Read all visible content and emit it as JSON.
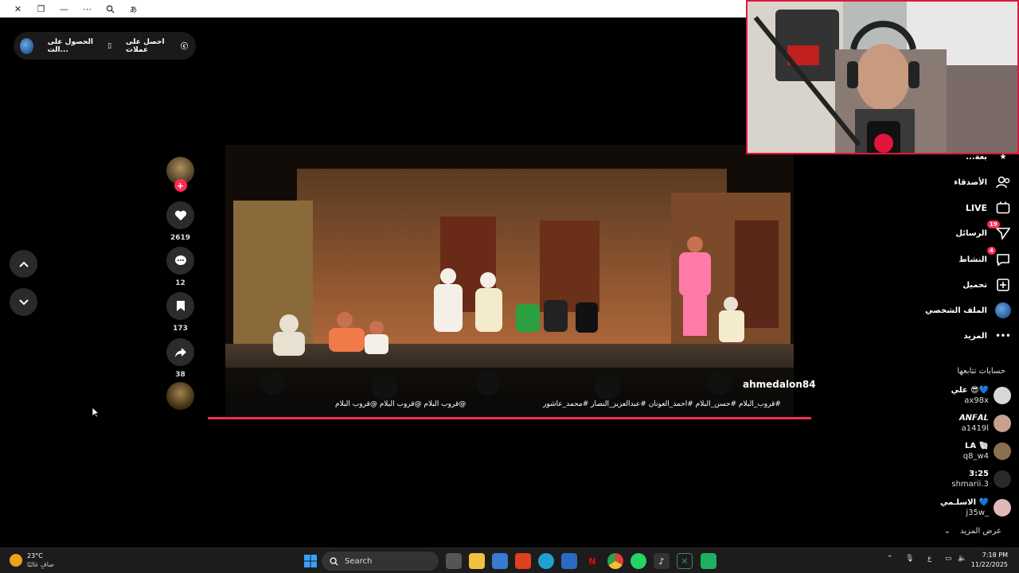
{
  "promo": {
    "get_coins": "احصل على عملات",
    "get_app": "الحصول على الت..."
  },
  "actions": {
    "likes": "2619",
    "comments": "12",
    "saves": "173",
    "shares": "38"
  },
  "video": {
    "author": "ahmedalon84",
    "hashtags": "#قروب_البلام #حسن_البلام #احمد_العونان #عبدالعزيز_النصار #محمد_عاشور",
    "mentions": "@قروب البلام @قروب البلام @قروب البلام"
  },
  "sidebar": {
    "partial_item": "...بعة",
    "friends": "الأصدقاء",
    "live": "LIVE",
    "messages": "الرسائل",
    "messages_badge": "19",
    "activity": "النشاط",
    "activity_badge": "4",
    "upload": "تحميل",
    "profile": "الملف الشخصي",
    "more": "المزيد"
  },
  "following": {
    "title": "حسابات تتابعها",
    "accounts": [
      {
        "name": "علي 😎💙",
        "handle": "ax98x"
      },
      {
        "name": "𝘼𝙉𝙁𝘼𝙇",
        "handle": "a1419l"
      },
      {
        "name": "LA 🐚",
        "handle": "q8_w4"
      },
      {
        "name": "3:25",
        "handle": "shmarii.3"
      },
      {
        "name": "الاسلـمي 💙",
        "handle": "j35w_"
      }
    ],
    "see_more": "عرض المزيد"
  },
  "taskbar": {
    "temp": "23°C",
    "weather": "صافٍ غالبًا",
    "search": "Search",
    "lang": "ع",
    "time": "7:18 PM",
    "date": "11/22/2025"
  },
  "colors": {
    "accent": "#fe2c55",
    "bg": "#000000"
  }
}
